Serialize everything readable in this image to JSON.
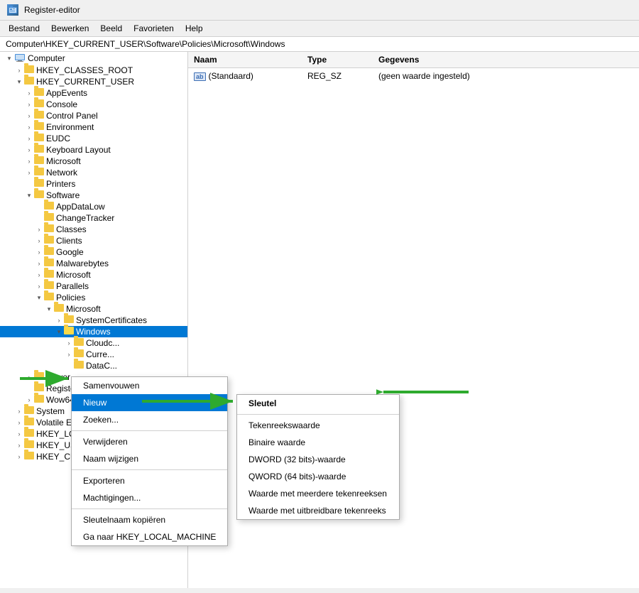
{
  "window": {
    "title": "Register-editor",
    "icon": "registry-icon"
  },
  "menubar": {
    "items": [
      "Bestand",
      "Bewerken",
      "Beeld",
      "Favorieten",
      "Help"
    ]
  },
  "address": "Computer\\HKEY_CURRENT_USER\\Software\\Policies\\Microsoft\\Windows",
  "tree": {
    "items": [
      {
        "id": "computer",
        "label": "Computer",
        "level": 0,
        "expanded": true,
        "type": "computer"
      },
      {
        "id": "hkey_classes_root",
        "label": "HKEY_CLASSES_ROOT",
        "level": 1,
        "expanded": false,
        "type": "folder"
      },
      {
        "id": "hkey_current_user",
        "label": "HKEY_CURRENT_USER",
        "level": 1,
        "expanded": true,
        "type": "folder"
      },
      {
        "id": "appevents",
        "label": "AppEvents",
        "level": 2,
        "expanded": false,
        "type": "folder"
      },
      {
        "id": "console",
        "label": "Console",
        "level": 2,
        "expanded": false,
        "type": "folder"
      },
      {
        "id": "control_panel",
        "label": "Control Panel",
        "level": 2,
        "expanded": false,
        "type": "folder"
      },
      {
        "id": "environment",
        "label": "Environment",
        "level": 2,
        "expanded": false,
        "type": "folder"
      },
      {
        "id": "eudc",
        "label": "EUDC",
        "level": 2,
        "expanded": false,
        "type": "folder"
      },
      {
        "id": "keyboard_layout",
        "label": "Keyboard Layout",
        "level": 2,
        "expanded": false,
        "type": "folder"
      },
      {
        "id": "microsoft",
        "label": "Microsoft",
        "level": 2,
        "expanded": false,
        "type": "folder"
      },
      {
        "id": "network",
        "label": "Network",
        "level": 2,
        "expanded": false,
        "type": "folder"
      },
      {
        "id": "printers",
        "label": "Printers",
        "level": 2,
        "expanded": false,
        "type": "folder"
      },
      {
        "id": "software",
        "label": "Software",
        "level": 2,
        "expanded": true,
        "type": "folder"
      },
      {
        "id": "appdatalow",
        "label": "AppDataLow",
        "level": 3,
        "expanded": false,
        "type": "folder"
      },
      {
        "id": "changetracker",
        "label": "ChangeTracker",
        "level": 3,
        "expanded": false,
        "type": "folder"
      },
      {
        "id": "classes",
        "label": "Classes",
        "level": 3,
        "expanded": false,
        "type": "folder"
      },
      {
        "id": "clients",
        "label": "Clients",
        "level": 3,
        "expanded": false,
        "type": "folder"
      },
      {
        "id": "google",
        "label": "Google",
        "level": 3,
        "expanded": false,
        "type": "folder"
      },
      {
        "id": "malwarebytes",
        "label": "Malwarebytes",
        "level": 3,
        "expanded": false,
        "type": "folder"
      },
      {
        "id": "microsoft2",
        "label": "Microsoft",
        "level": 3,
        "expanded": false,
        "type": "folder"
      },
      {
        "id": "parallels",
        "label": "Parallels",
        "level": 3,
        "expanded": false,
        "type": "folder"
      },
      {
        "id": "policies",
        "label": "Policies",
        "level": 3,
        "expanded": true,
        "type": "folder"
      },
      {
        "id": "pol_microsoft",
        "label": "Microsoft",
        "level": 4,
        "expanded": true,
        "type": "folder"
      },
      {
        "id": "systemcertificates",
        "label": "SystemCertificates",
        "level": 5,
        "expanded": false,
        "type": "folder"
      },
      {
        "id": "windows",
        "label": "Windows",
        "level": 5,
        "expanded": true,
        "type": "folder",
        "selected": true
      },
      {
        "id": "cloudc",
        "label": "Cloudc...",
        "level": 6,
        "expanded": false,
        "type": "folder"
      },
      {
        "id": "curre",
        "label": "Curre...",
        "level": 6,
        "expanded": false,
        "type": "folder"
      },
      {
        "id": "datac",
        "label": "DataC...",
        "level": 6,
        "expanded": false,
        "type": "folder"
      },
      {
        "id": "power",
        "label": "Power",
        "level": 2,
        "expanded": false,
        "type": "folder"
      },
      {
        "id": "registeredapp",
        "label": "RegisteredApp...",
        "level": 2,
        "expanded": false,
        "type": "folder"
      },
      {
        "id": "wow6432node",
        "label": "Wow6432Node...",
        "level": 2,
        "expanded": false,
        "type": "folder"
      },
      {
        "id": "system",
        "label": "System",
        "level": 2,
        "expanded": false,
        "type": "folder"
      },
      {
        "id": "volatile_environ",
        "label": "Volatile Environ...",
        "level": 2,
        "expanded": false,
        "type": "folder"
      },
      {
        "id": "hkey_local_machi",
        "label": "HKEY_LOCAL_MACHI...",
        "level": 1,
        "expanded": false,
        "type": "folder"
      },
      {
        "id": "hkey_users",
        "label": "HKEY_USERS",
        "level": 1,
        "expanded": false,
        "type": "folder"
      },
      {
        "id": "hkey_current_con",
        "label": "HKEY_CURRENT_CON...",
        "level": 1,
        "expanded": false,
        "type": "folder"
      }
    ]
  },
  "details": {
    "columns": [
      "Naam",
      "Type",
      "Gegevens"
    ],
    "rows": [
      {
        "naam": "(Standaard)",
        "type": "REG_SZ",
        "gegevens": "(geen waarde ingesteld)"
      }
    ]
  },
  "context_menu": {
    "items": [
      {
        "label": "Samenvouwen",
        "type": "item"
      },
      {
        "label": "Nieuw",
        "type": "item",
        "has_submenu": true,
        "active": true
      },
      {
        "label": "Zoeken...",
        "type": "item"
      },
      {
        "label": "separator"
      },
      {
        "label": "Verwijderen",
        "type": "item"
      },
      {
        "label": "Naam wijzigen",
        "type": "item"
      },
      {
        "label": "separator"
      },
      {
        "label": "Exporteren",
        "type": "item"
      },
      {
        "label": "Machtigingen...",
        "type": "item"
      },
      {
        "label": "separator"
      },
      {
        "label": "Sleutelnaam kopiëren",
        "type": "item"
      },
      {
        "label": "Ga naar HKEY_LOCAL_MACHINE",
        "type": "item"
      }
    ]
  },
  "sub_menu": {
    "items": [
      {
        "label": "Sleutel",
        "highlighted": true
      },
      {
        "label": ""
      },
      {
        "label": "Tekenreekswaarde"
      },
      {
        "label": "Binaire waarde"
      },
      {
        "label": "DWORD (32 bits)-waarde"
      },
      {
        "label": "QWORD (64 bits)-waarde"
      },
      {
        "label": "Waarde met meerdere tekenreeksen"
      },
      {
        "label": "Waarde met uitbreidbare tekenreeks"
      }
    ]
  }
}
